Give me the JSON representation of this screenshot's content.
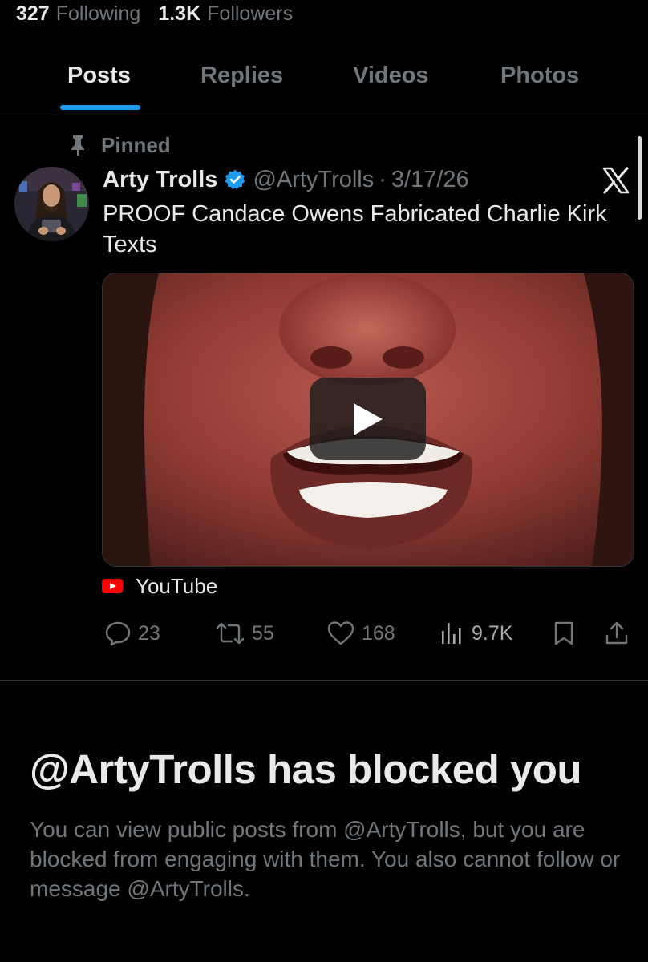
{
  "profile_stats": {
    "following_count": "327",
    "following_label": "Following",
    "followers_count": "1.3K",
    "followers_label": "Followers"
  },
  "tabs": [
    {
      "label": "Posts",
      "active": true
    },
    {
      "label": "Replies",
      "active": false
    },
    {
      "label": "Videos",
      "active": false
    },
    {
      "label": "Photos",
      "active": false
    }
  ],
  "post": {
    "pinned_label": "Pinned",
    "author_name": "Arty Trolls",
    "author_handle": "@ArtyTrolls",
    "separator": "·",
    "date": "3/17/26",
    "text": "PROOF Candace Owens Fabricated Charlie Kirk Texts",
    "media_source": "YouTube",
    "stats": {
      "replies": "23",
      "reposts": "55",
      "likes": "168",
      "views": "9.7K"
    }
  },
  "blocked": {
    "title": "@ArtyTrolls has blocked you",
    "description": "You can view public posts from @ArtyTrolls, but you are blocked from engaging with them. You also cannot follow or message @ArtyTrolls."
  },
  "icons": {
    "pin": "pin-icon",
    "verified": "verified-badge-icon",
    "x_logo": "x-logo-icon",
    "play": "play-icon",
    "youtube": "youtube-icon",
    "reply": "reply-icon",
    "repost": "repost-icon",
    "like": "like-icon",
    "views": "views-icon",
    "bookmark": "bookmark-icon",
    "share": "share-icon"
  },
  "colors": {
    "accent": "#1d9bf0",
    "background": "#000000",
    "primary_text": "#e7e9ea",
    "secondary_text": "#71767b",
    "youtube_red": "#ff0000"
  }
}
